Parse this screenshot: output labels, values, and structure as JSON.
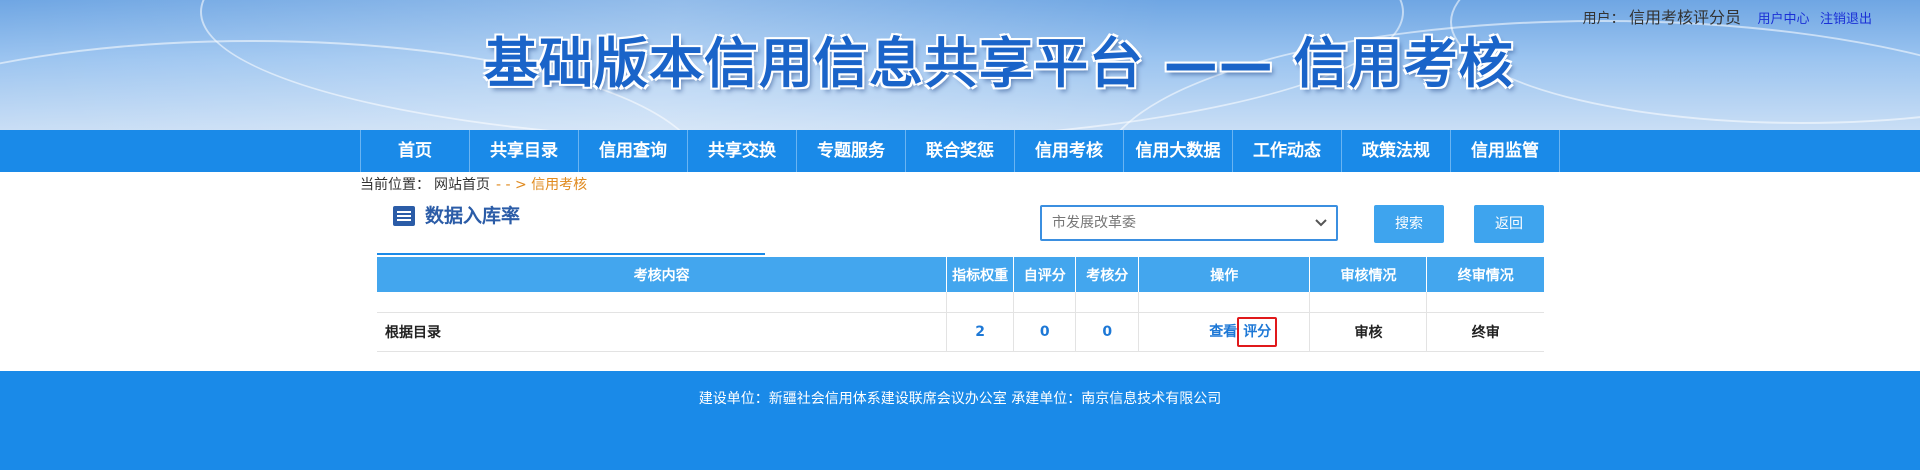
{
  "header": {
    "site_title": "基础版本信用信息共享平台 —— 信用考核",
    "user_label": "用户：",
    "user_name": "信用考核评分员",
    "user_center": "用户中心",
    "logout": "注销退出"
  },
  "nav": {
    "items": [
      "首页",
      "共享目录",
      "信用查询",
      "共享交换",
      "专题服务",
      "联合奖惩",
      "信用考核",
      "信用大数据",
      "工作动态",
      "政策法规",
      "信用监管"
    ]
  },
  "breadcrumb": {
    "label": "当前位置：",
    "home": "网站首页",
    "current": "- - > 信用考核"
  },
  "section": {
    "title": "数据入库率",
    "icon": "list-icon"
  },
  "search": {
    "department_selected": "市发展改革委",
    "search_label": "搜索",
    "back_label": "返回"
  },
  "table": {
    "headers": [
      "考核内容",
      "指标权重",
      "自评分",
      "考核分",
      "操作",
      "审核情况",
      "终审情况"
    ],
    "rows": [
      {
        "content": "根据目录",
        "weight": "2",
        "self_score": "0",
        "assess_score": "0",
        "op_view": "查看",
        "op_score": "评分",
        "review": "审核",
        "final_review": "终审"
      }
    ]
  },
  "footer": {
    "text": "建设单位：新疆社会信用体系建设联席会议办公室  承建单位：南京信息技术有限公司"
  },
  "colors": {
    "nav_bg": "#1a8ae8",
    "table_header_bg": "#43a6ee",
    "title_blue": "#1a64c9",
    "breadcrumb_current": "#e08a1e",
    "highlight_border": "#e0191b"
  }
}
